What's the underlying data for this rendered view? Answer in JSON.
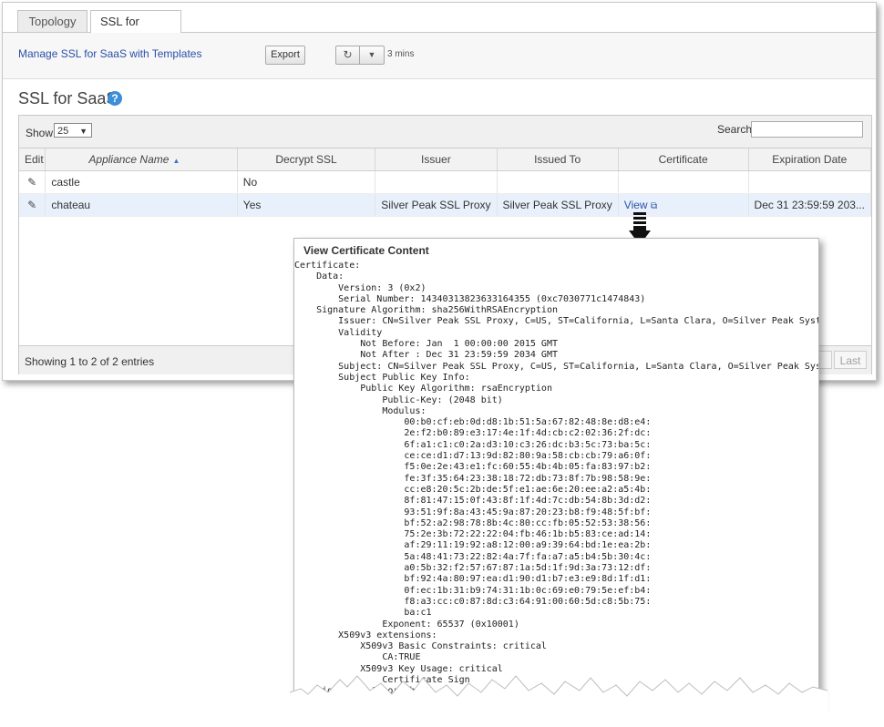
{
  "tabs": {
    "topology": "Topology",
    "ssl_saas": "SSL for SaaS",
    "close_glyph": "×"
  },
  "toolbar": {
    "manage_link": "Manage SSL for SaaS with Templates",
    "export_label": "Export",
    "refresh_icon": "↻",
    "dropdown_icon": "▼",
    "interval": "3 mins"
  },
  "page": {
    "title": "SSL for SaaS",
    "help_icon": "?"
  },
  "controls": {
    "show_label": "Show",
    "show_value": "25",
    "search_label": "Search",
    "search_value": ""
  },
  "table": {
    "headers": {
      "edit": "Edit",
      "appliance": "Appliance Name",
      "decrypt": "Decrypt SSL",
      "issuer": "Issuer",
      "issued_to": "Issued To",
      "certificate": "Certificate",
      "expiration": "Expiration Date"
    },
    "rows": [
      {
        "edit_icon": "✎",
        "appliance": "castle",
        "decrypt": "No",
        "issuer": "",
        "issued_to": "",
        "certificate": "",
        "expiration": ""
      },
      {
        "edit_icon": "✎",
        "appliance": "chateau",
        "decrypt": "Yes",
        "issuer": "Silver Peak SSL Proxy",
        "issued_to": "Silver Peak SSL Proxy",
        "certificate": "View",
        "expiration": "Dec 31 23:59:59 203..."
      }
    ]
  },
  "footer": {
    "showing": "Showing 1 to 2 of 2 entries",
    "next": "t",
    "last": "Last"
  },
  "cert_popup": {
    "title": "View Certificate Content",
    "content": "Certificate:\n    Data:\n        Version: 3 (0x2)\n        Serial Number: 14340313823633164355 (0xc7030771c1474843)\n    Signature Algorithm: sha256WithRSAEncryption\n        Issuer: CN=Silver Peak SSL Proxy, C=US, ST=California, L=Santa Clara, O=Silver Peak Systems\n        Validity\n            Not Before: Jan  1 00:00:00 2015 GMT\n            Not After : Dec 31 23:59:59 2034 GMT\n        Subject: CN=Silver Peak SSL Proxy, C=US, ST=California, L=Santa Clara, O=Silver Peak Systems\n        Subject Public Key Info:\n            Public Key Algorithm: rsaEncryption\n                Public-Key: (2048 bit)\n                Modulus:\n                    00:b0:cf:eb:0d:d8:1b:51:5a:67:82:48:8e:d8:e4:\n                    2e:f2:b0:89:e3:17:4e:1f:4d:cb:c2:02:36:2f:dc:\n                    6f:a1:c1:c0:2a:d3:10:c3:26:dc:b3:5c:73:ba:5c:\n                    ce:ce:d1:d7:13:9d:82:80:9a:58:cb:cb:79:a6:0f:\n                    f5:0e:2e:43:e1:fc:60:55:4b:4b:05:fa:83:97:b2:\n                    fe:3f:35:64:23:38:18:72:db:73:8f:7b:98:58:9e:\n                    cc:e8:20:5c:2b:de:5f:e1:ae:6e:20:ee:a2:a5:4b:\n                    8f:81:47:15:0f:43:8f:1f:4d:7c:db:54:8b:3d:d2:\n                    93:51:9f:8a:43:45:9a:87:20:23:b8:f9:48:5f:bf:\n                    bf:52:a2:98:78:8b:4c:80:cc:fb:05:52:53:38:56:\n                    75:2e:3b:72:22:22:04:fb:46:1b:b5:83:ce:ad:14:\n                    af:29:11:19:92:a8:12:00:a9:39:64:bd:1e:ea:2b:\n                    5a:48:41:73:22:82:4a:7f:fa:a7:a5:b4:5b:30:4c:\n                    a0:5b:32:f2:57:67:87:1a:5d:1f:9d:3a:73:12:df:\n                    bf:92:4a:80:97:ea:d1:90:d1:b7:e3:e9:8d:1f:d1:\n                    0f:ec:1b:31:b9:74:31:1b:0c:69:e0:79:5e:ef:b4:\n                    f8:a3:cc:c0:87:8d:c3:64:91:00:60:5d:c8:5b:75:\n                    ba:c1\n                Exponent: 65537 (0x10001)\n        X509v3 extensions:\n            X509v3 Basic Constraints: critical\n                CA:TRUE\n            X509v3 Key Usage: critical\n                Certificate Sign\n    Signature Algorithm"
  }
}
